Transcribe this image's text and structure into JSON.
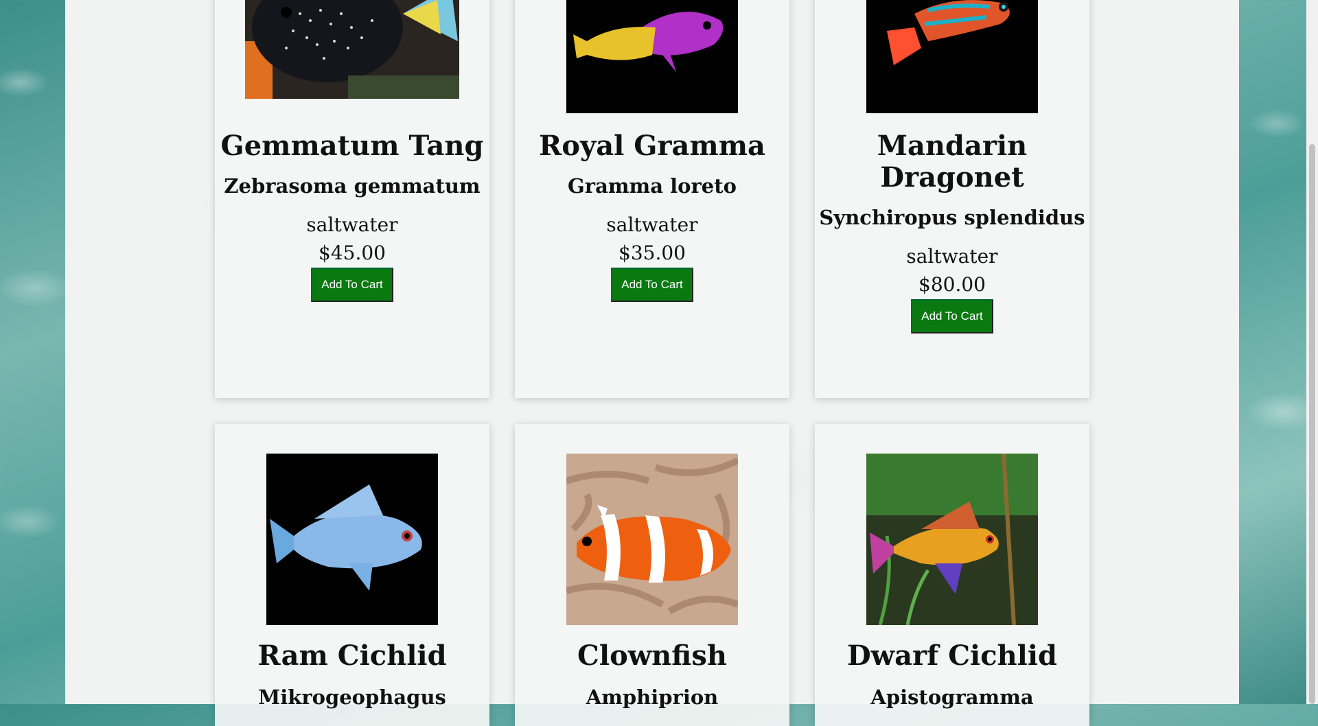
{
  "products": [
    {
      "name": "Gemmatum Tang",
      "species": "Zebrasoma gemmatum",
      "type": "saltwater",
      "price": "$45.00",
      "button": "Add To Cart",
      "image_icon": "tang-fish-icon"
    },
    {
      "name": "Royal Gramma",
      "species": "Gramma loreto",
      "type": "saltwater",
      "price": "$35.00",
      "button": "Add To Cart",
      "image_icon": "gramma-fish-icon"
    },
    {
      "name": "Mandarin Dragonet",
      "species": "Synchiropus splendidus",
      "type": "saltwater",
      "price": "$80.00",
      "button": "Add To Cart",
      "image_icon": "dragonet-fish-icon"
    },
    {
      "name": "Ram Cichlid",
      "species": "Mikrogeophagus",
      "image_icon": "cichlid-fish-icon"
    },
    {
      "name": "Clownfish",
      "species": "Amphiprion",
      "image_icon": "clownfish-icon"
    },
    {
      "name": "Dwarf Cichlid",
      "species": "Apistogramma",
      "image_icon": "dwarf-cichlid-fish-icon"
    }
  ],
  "colors": {
    "button": "#0a7a10",
    "panel": "#f1f3f2"
  }
}
